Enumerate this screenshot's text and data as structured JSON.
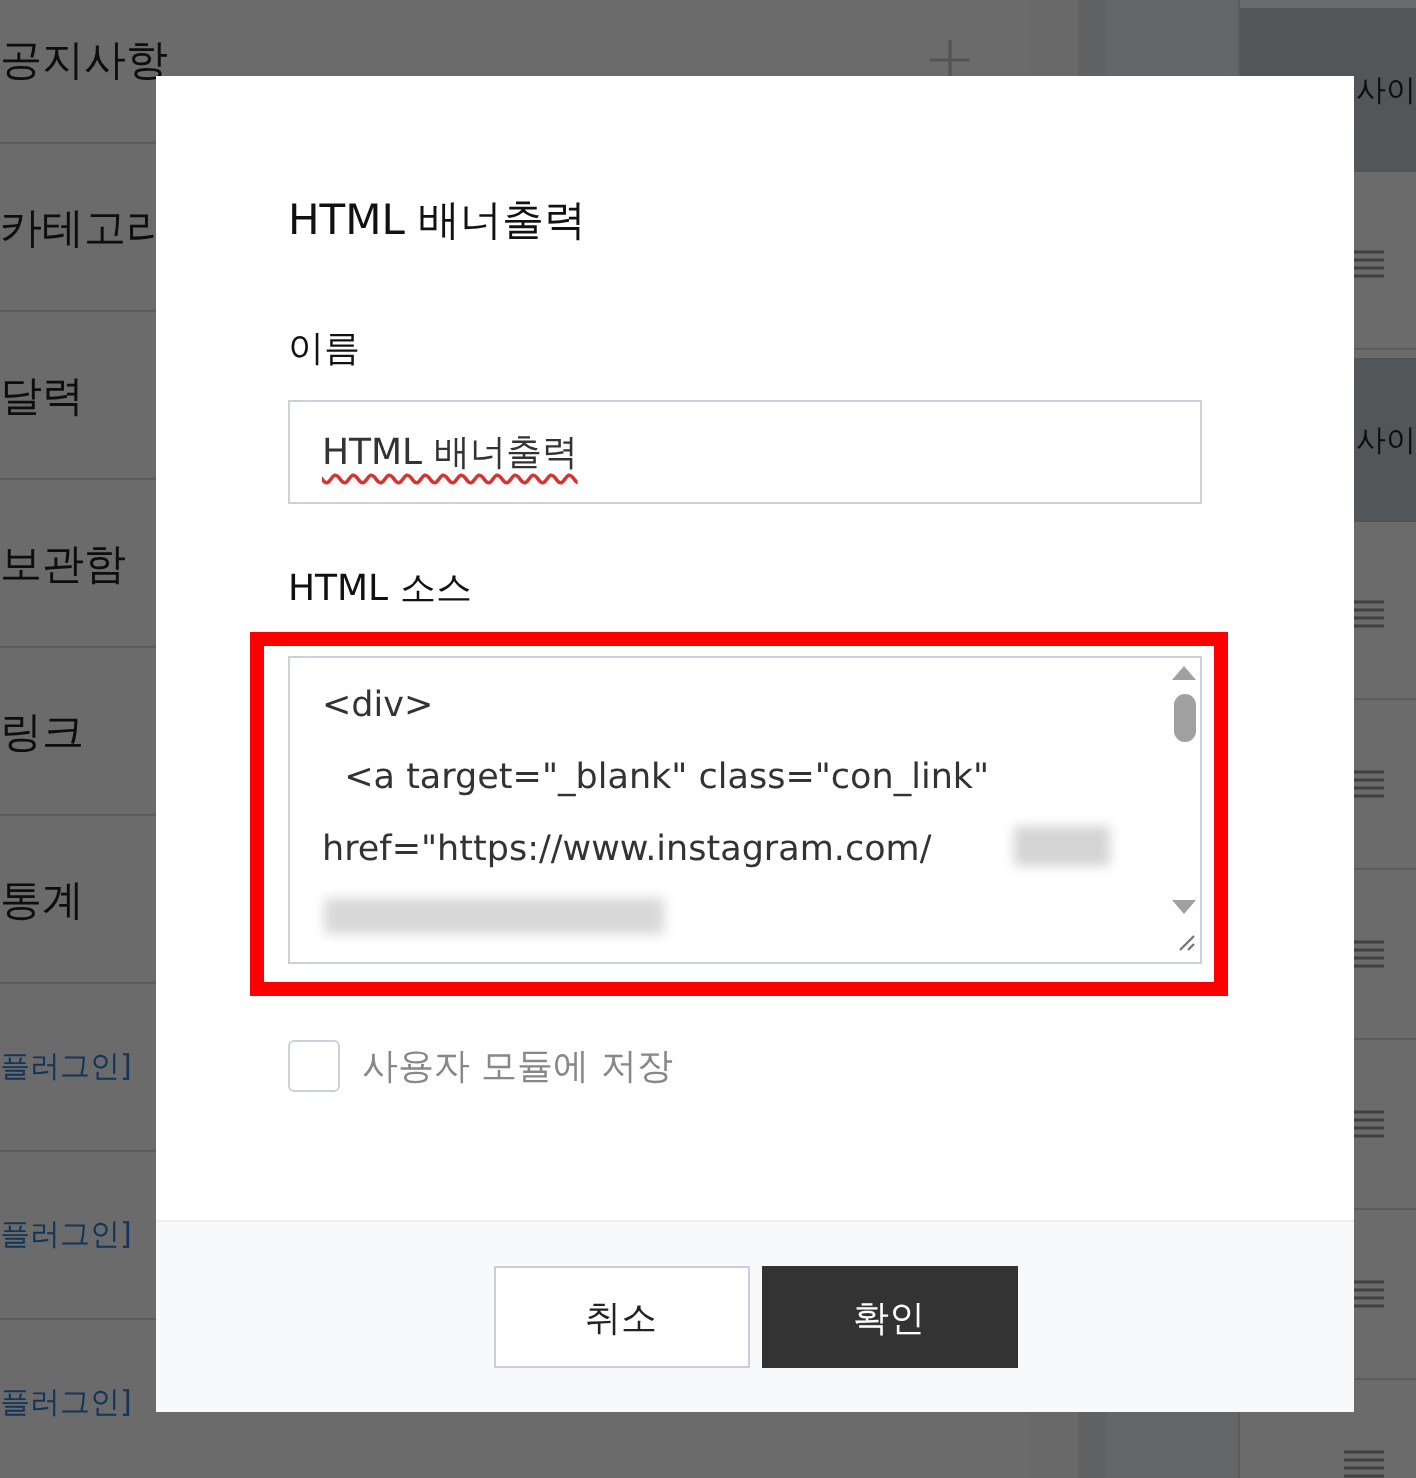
{
  "background": {
    "menu_items": [
      {
        "label": "공지사항",
        "kind": "section"
      },
      {
        "label": "카테고리",
        "kind": "plain"
      },
      {
        "label": "달력",
        "kind": "plain"
      },
      {
        "label": "보관함",
        "kind": "plain"
      },
      {
        "label": "링크",
        "kind": "plain"
      },
      {
        "label": "통계",
        "kind": "plain"
      },
      {
        "label": "플러그인]",
        "kind": "link"
      },
      {
        "label": "플러그인]",
        "kind": "link"
      },
      {
        "label": "플러그인]",
        "kind": "link"
      }
    ],
    "side_items": [
      {
        "kind": "panel",
        "label": "사이"
      },
      {
        "kind": "row"
      },
      {
        "kind": "panel",
        "label": "사이"
      },
      {
        "kind": "row"
      },
      {
        "kind": "row"
      },
      {
        "kind": "row"
      },
      {
        "kind": "row"
      },
      {
        "kind": "row"
      },
      {
        "kind": "row"
      }
    ]
  },
  "dialog": {
    "title": "HTML 배너출력",
    "name_label": "이름",
    "name_value": "HTML 배너출력",
    "source_label": "HTML 소스",
    "source_lines": [
      "<div>",
      "  <a target=\"_blank\" class=\"con_link\"",
      "href=\"https://www.instagram.com/"
    ],
    "save_module": {
      "label": "사용자 모듈에 저장",
      "checked": false
    },
    "buttons": [
      {
        "label": "취소",
        "kind": "secondary"
      },
      {
        "label": "확인",
        "kind": "primary"
      }
    ]
  }
}
